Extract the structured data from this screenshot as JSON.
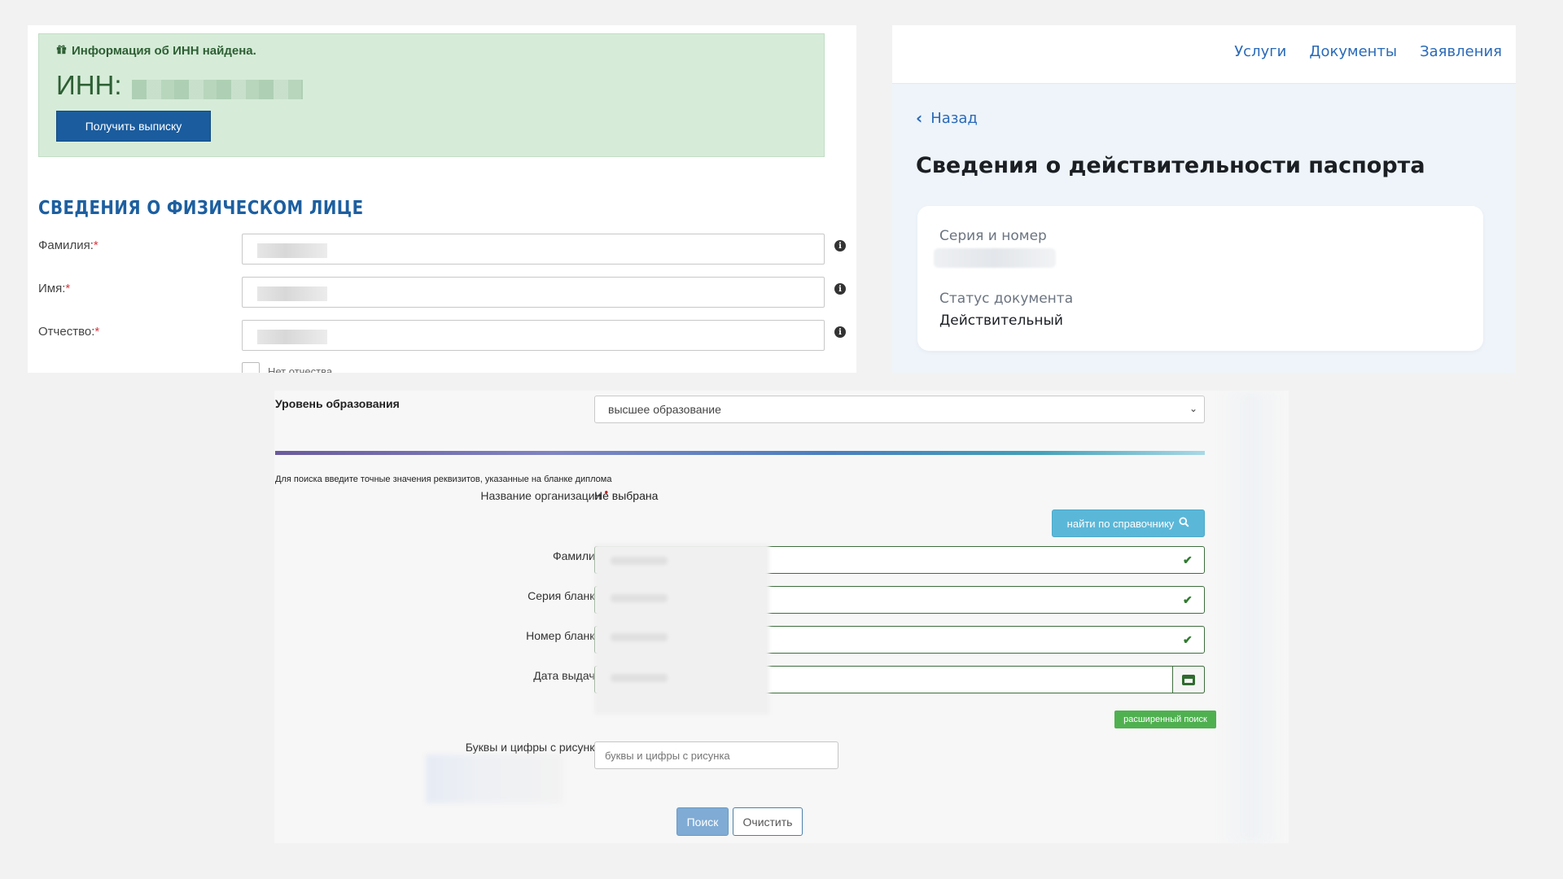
{
  "inn_panel": {
    "found_message": "Информация об ИНН найдена.",
    "inn_label": "ИНН:",
    "get_extract_button": "Получить выписку",
    "section_title": "СВЕДЕНИЯ О ФИЗИЧЕСКОМ ЛИЦЕ",
    "fields": [
      {
        "label": "Фамилия:",
        "required": "*"
      },
      {
        "label": "Имя:",
        "required": "*"
      },
      {
        "label": "Отчество:",
        "required": "*"
      }
    ],
    "no_patronymic_label": "Нет отчества"
  },
  "passport_panel": {
    "nav": [
      "Услуги",
      "Документы",
      "Заявления"
    ],
    "back_label": "Назад",
    "title": "Сведения о действительности паспорта",
    "series_label": "Серия и номер",
    "status_label": "Статус документа",
    "status_value": "Действительный"
  },
  "diploma_panel": {
    "education_level_label": "Уровень образования",
    "education_level_value": "высшее образование",
    "hint": "Для поиска введите точные значения реквизитов, указанные на бланке диплома",
    "org_label": "Название организации",
    "org_value": "Не выбрана",
    "directory_button": "найти по справочнику",
    "fields": [
      {
        "label": "Фамилия"
      },
      {
        "label": "Серия бланка"
      },
      {
        "label": "Номер бланка"
      },
      {
        "label": "Дата выдачи"
      }
    ],
    "advanced_search": "расширенный поиск",
    "captcha_label": "Буквы и цифры с рисунка",
    "captcha_placeholder": "буквы и цифры с рисунка",
    "search_button": "Поиск",
    "clear_button": "Очистить",
    "required_mark": "•"
  },
  "colors": {
    "inn_success_bg": "#d6ecd8",
    "primary_blue": "#1a5c9e",
    "link_blue": "#2a6ab8",
    "valid_green": "#2f7a2f"
  },
  "icons": [
    "gift-icon",
    "info-icon",
    "chevron-left-icon",
    "chevron-down-icon",
    "search-icon",
    "check-icon",
    "calendar-icon"
  ]
}
